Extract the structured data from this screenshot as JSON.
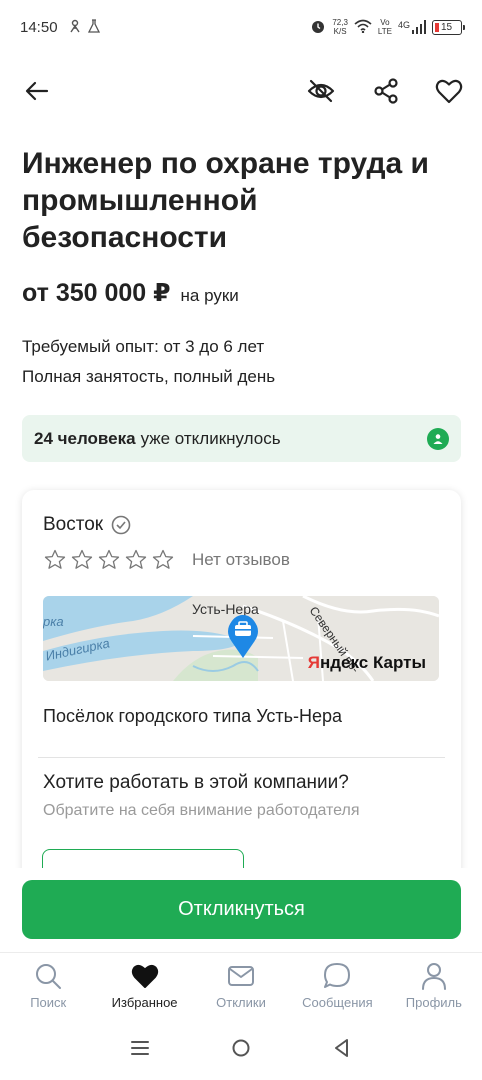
{
  "status_bar": {
    "time": "14:50",
    "speed_value": "72,3",
    "speed_unit": "K/S",
    "volte": "Vo",
    "lte": "LTE",
    "network": "4G",
    "battery": "15"
  },
  "vacancy": {
    "title": "Инженер по охране труда и промышленной безопасности",
    "salary": "от 350 000 ₽",
    "salary_suffix": "на руки",
    "experience": "Требуемый опыт: от 3 до 6 лет",
    "employment": "Полная занятость, полный день",
    "responded_count": "24 человека",
    "responded_text": "уже откликнулось"
  },
  "company": {
    "name": "Восток",
    "no_reviews": "Нет отзывов",
    "map_city": "Усть-Нера",
    "map_river": "Индигирка",
    "map_road": "Северный пр-",
    "map_brand_y": "Я",
    "map_brand_rest": "ндекс Карты",
    "address": "Посёлок городского типа Усть-Нера",
    "want_title": "Хотите работать в этой компании?",
    "want_subtitle": "Обратите на себя внимание работодателя"
  },
  "cta": {
    "label": "Откликнуться"
  },
  "bottom_nav": [
    {
      "label": "Поиск",
      "icon": "search-icon"
    },
    {
      "label": "Избранное",
      "icon": "heart-filled-icon"
    },
    {
      "label": "Отклики",
      "icon": "mail-icon"
    },
    {
      "label": "Сообщения",
      "icon": "chat-bubble-icon"
    },
    {
      "label": "Профиль",
      "icon": "person-icon"
    }
  ],
  "colors": {
    "accent": "#1fab54",
    "accent_light": "#eaf5ee",
    "muted": "#8a96a6"
  }
}
